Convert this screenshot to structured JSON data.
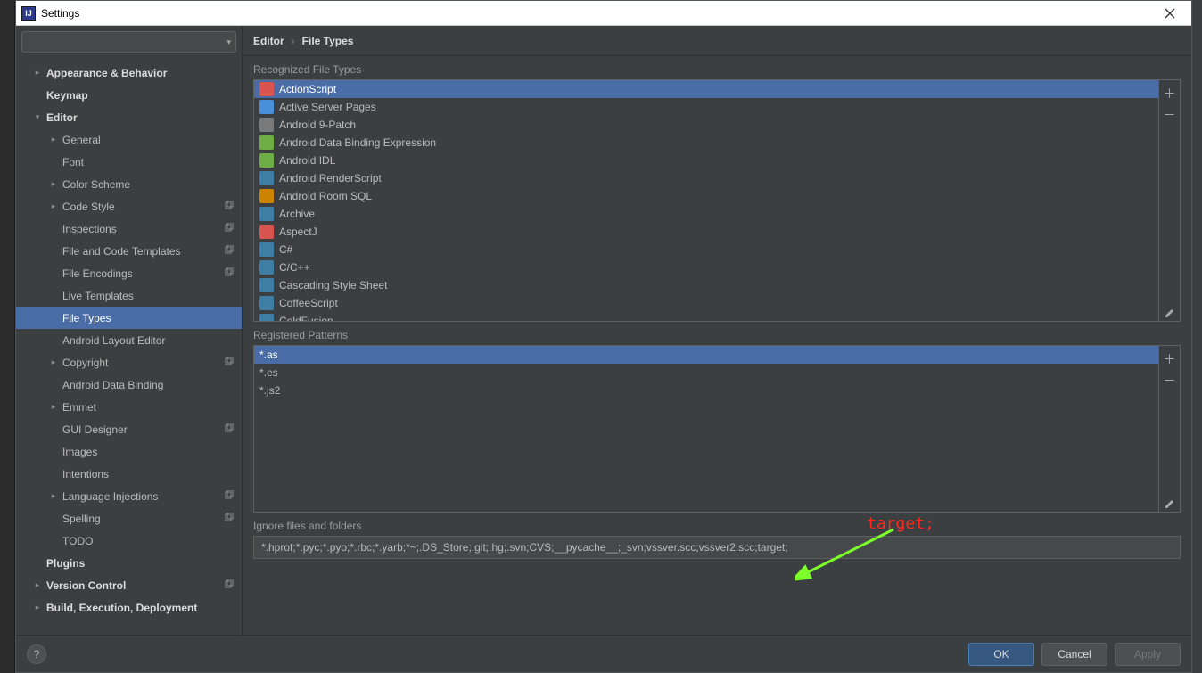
{
  "window": {
    "title": "Settings"
  },
  "search": {
    "placeholder": ""
  },
  "tree": [
    {
      "label": "Appearance & Behavior",
      "bold": true,
      "depth": 0,
      "chev": "collapsed",
      "copy": false
    },
    {
      "label": "Keymap",
      "bold": true,
      "depth": 0,
      "chev": "none",
      "copy": false
    },
    {
      "label": "Editor",
      "bold": true,
      "depth": 0,
      "chev": "expanded",
      "copy": false
    },
    {
      "label": "General",
      "bold": false,
      "depth": 1,
      "chev": "collapsed",
      "copy": false
    },
    {
      "label": "Font",
      "bold": false,
      "depth": 1,
      "chev": "none",
      "copy": false
    },
    {
      "label": "Color Scheme",
      "bold": false,
      "depth": 1,
      "chev": "collapsed",
      "copy": false
    },
    {
      "label": "Code Style",
      "bold": false,
      "depth": 1,
      "chev": "collapsed",
      "copy": true
    },
    {
      "label": "Inspections",
      "bold": false,
      "depth": 1,
      "chev": "none",
      "copy": true
    },
    {
      "label": "File and Code Templates",
      "bold": false,
      "depth": 1,
      "chev": "none",
      "copy": true
    },
    {
      "label": "File Encodings",
      "bold": false,
      "depth": 1,
      "chev": "none",
      "copy": true
    },
    {
      "label": "Live Templates",
      "bold": false,
      "depth": 1,
      "chev": "none",
      "copy": false
    },
    {
      "label": "File Types",
      "bold": false,
      "depth": 1,
      "chev": "none",
      "copy": false,
      "selected": true
    },
    {
      "label": "Android Layout Editor",
      "bold": false,
      "depth": 1,
      "chev": "none",
      "copy": false
    },
    {
      "label": "Copyright",
      "bold": false,
      "depth": 1,
      "chev": "collapsed",
      "copy": true
    },
    {
      "label": "Android Data Binding",
      "bold": false,
      "depth": 1,
      "chev": "none",
      "copy": false
    },
    {
      "label": "Emmet",
      "bold": false,
      "depth": 1,
      "chev": "collapsed",
      "copy": false
    },
    {
      "label": "GUI Designer",
      "bold": false,
      "depth": 1,
      "chev": "none",
      "copy": true
    },
    {
      "label": "Images",
      "bold": false,
      "depth": 1,
      "chev": "none",
      "copy": false
    },
    {
      "label": "Intentions",
      "bold": false,
      "depth": 1,
      "chev": "none",
      "copy": false
    },
    {
      "label": "Language Injections",
      "bold": false,
      "depth": 1,
      "chev": "collapsed",
      "copy": true
    },
    {
      "label": "Spelling",
      "bold": false,
      "depth": 1,
      "chev": "none",
      "copy": true
    },
    {
      "label": "TODO",
      "bold": false,
      "depth": 1,
      "chev": "none",
      "copy": false
    },
    {
      "label": "Plugins",
      "bold": true,
      "depth": 0,
      "chev": "none",
      "copy": false
    },
    {
      "label": "Version Control",
      "bold": true,
      "depth": 0,
      "chev": "collapsed",
      "copy": true
    },
    {
      "label": "Build, Execution, Deployment",
      "bold": true,
      "depth": 0,
      "chev": "collapsed",
      "copy": false
    }
  ],
  "breadcrumb": {
    "a": "Editor",
    "b": "File Types"
  },
  "sections": {
    "recognized": "Recognized File Types",
    "patterns": "Registered Patterns",
    "ignore": "Ignore files and folders"
  },
  "filetypes": [
    {
      "name": "ActionScript",
      "icon_bg": "#d9534f",
      "selected": true
    },
    {
      "name": "Active Server Pages",
      "icon_bg": "#4a90d9"
    },
    {
      "name": "Android 9-Patch",
      "icon_bg": "#7a7a7a"
    },
    {
      "name": "Android Data Binding Expression",
      "icon_bg": "#6fae45"
    },
    {
      "name": "Android IDL",
      "icon_bg": "#6fae45"
    },
    {
      "name": "Android RenderScript",
      "icon_bg": "#3e7ea5"
    },
    {
      "name": "Android Room SQL",
      "icon_bg": "#cc8400"
    },
    {
      "name": "Archive",
      "icon_bg": "#3e7ea5"
    },
    {
      "name": "AspectJ",
      "icon_bg": "#d9534f"
    },
    {
      "name": "C#",
      "icon_bg": "#3e7ea5"
    },
    {
      "name": "C/C++",
      "icon_bg": "#3e7ea5"
    },
    {
      "name": "Cascading Style Sheet",
      "icon_bg": "#3e7ea5"
    },
    {
      "name": "CoffeeScript",
      "icon_bg": "#3e7ea5"
    },
    {
      "name": "ColdFusion",
      "icon_bg": "#3e7ea5"
    }
  ],
  "patterns": [
    {
      "name": "*.as",
      "selected": true
    },
    {
      "name": "*.es"
    },
    {
      "name": "*.js2"
    }
  ],
  "ignore_value": "*.hprof;*.pyc;*.pyo;*.rbc;*.yarb;*~;.DS_Store;.git;.hg;.svn;CVS;__pycache__;_svn;vssver.scc;vssver2.scc;target;",
  "buttons": {
    "ok": "OK",
    "cancel": "Cancel",
    "apply": "Apply"
  },
  "annotation": {
    "label": "target;"
  }
}
